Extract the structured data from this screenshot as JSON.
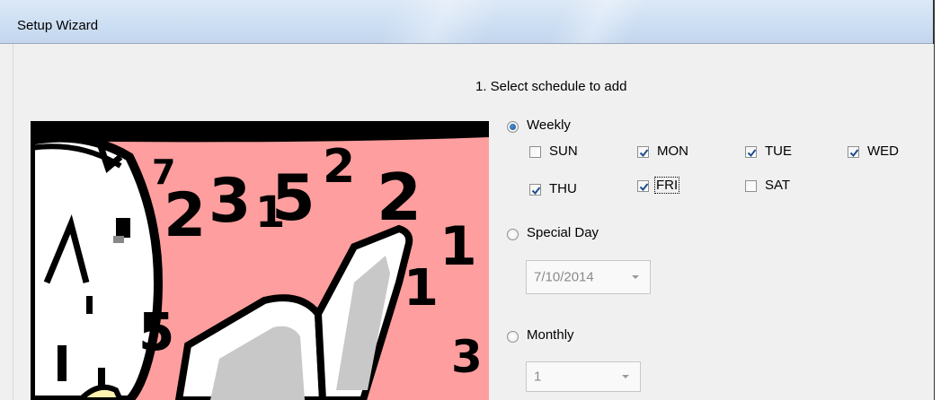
{
  "window": {
    "title": "Setup Wizard"
  },
  "step": {
    "heading": "1. Select schedule to add"
  },
  "options": {
    "weekly": {
      "label": "Weekly",
      "selected": true
    },
    "special_day": {
      "label": "Special Day",
      "selected": false,
      "date_value": "7/10/2014"
    },
    "monthly": {
      "label": "Monthly",
      "selected": false,
      "day_value": "1"
    }
  },
  "days": [
    {
      "label": "SUN",
      "checked": false
    },
    {
      "label": "MON",
      "checked": true
    },
    {
      "label": "TUE",
      "checked": true
    },
    {
      "label": "WED",
      "checked": true
    },
    {
      "label": "THU",
      "checked": true
    },
    {
      "label": "FRI",
      "checked": true,
      "focused": true
    },
    {
      "label": "SAT",
      "checked": false
    }
  ],
  "illustration": {
    "icon": "calendar-clock-illustration",
    "numerals": [
      "7",
      "2",
      "3",
      "1",
      "5",
      "2",
      "2",
      "1",
      "5",
      "1",
      "3"
    ]
  },
  "colors": {
    "accent_check": "#1e4f8f",
    "illustration_bg": "#ff9e9e"
  }
}
